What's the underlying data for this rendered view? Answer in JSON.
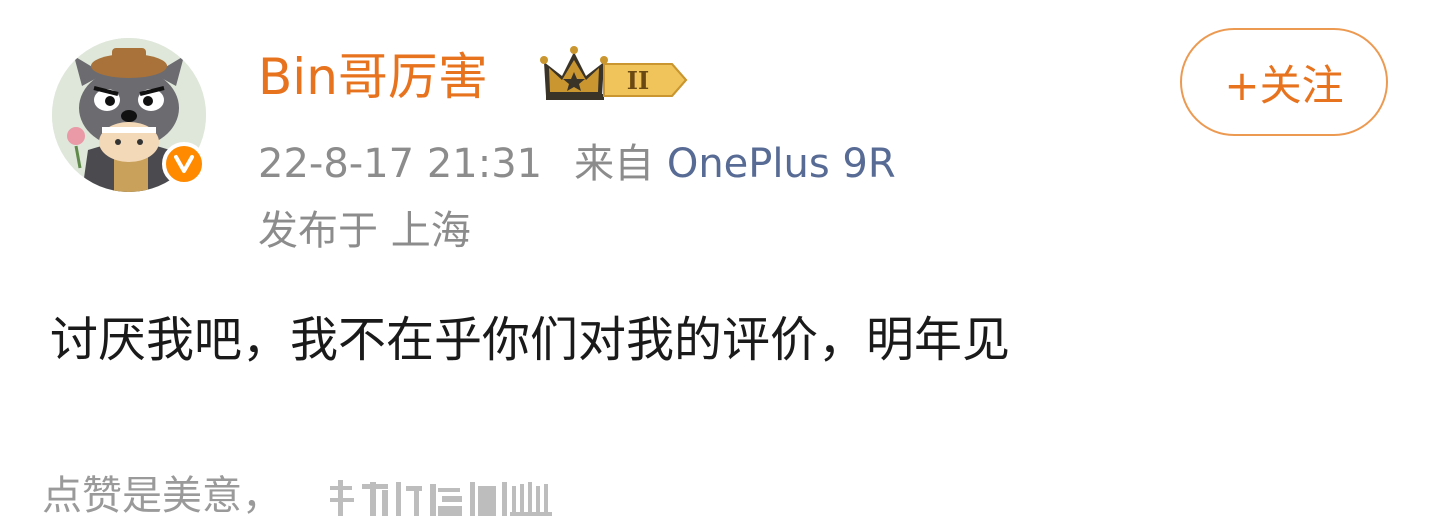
{
  "post": {
    "author": {
      "name": "Bin哥厉害",
      "level_badge_text": "II"
    },
    "follow_label": "+关注",
    "timestamp": "22-8-17 21:31",
    "source_prefix": "来自",
    "device": "OnePlus 9R",
    "location": "发布于 上海",
    "content": "讨厌我吧，我不在乎你们对我的评价，明年见"
  },
  "footer": {
    "note": "点赞是美意，"
  },
  "colors": {
    "username": "#e8731f",
    "follow_border": "#ec9a52",
    "device_link": "#576b95",
    "meta_gray": "#8c8c8c",
    "verified_badge": "#ff8a00"
  }
}
